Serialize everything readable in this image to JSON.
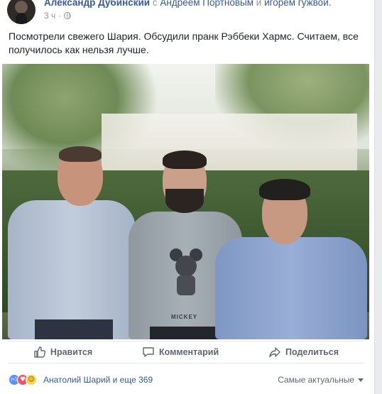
{
  "post": {
    "author": "Александр Дубинский",
    "with_word": "с",
    "tagged_1": "Андреем Портновым",
    "and_word": "и",
    "tagged_2": "игорем гужвой.",
    "time": "3 ч",
    "time_sep": "·",
    "privacy_icon": "globe-icon",
    "text": "Посмотрели свежего Шария. Обсудили пранк Рэббеки Хармс. Считаем, все получилось как нельзя лучше."
  },
  "photo": {
    "shirt_text": "MICKEY"
  },
  "actions": {
    "like_label": "Нравится",
    "like_icon": "thumbs-up-icon",
    "comment_label": "Комментарий",
    "comment_icon": "comment-bubble-icon",
    "share_label": "Поделиться",
    "share_icon": "share-arrow-icon"
  },
  "reactions": {
    "icons": [
      "like-reaction-icon",
      "love-reaction-icon",
      "haha-reaction-icon"
    ],
    "summary": "Анатолий Шарий и еще 369",
    "sort_label": "Самые актуальные"
  },
  "colors": {
    "link": "#365899",
    "secondary_text": "#90949c",
    "like_blue": "#5890ff",
    "love_red": "#f25268",
    "haha_yellow": "#fcd24f"
  }
}
